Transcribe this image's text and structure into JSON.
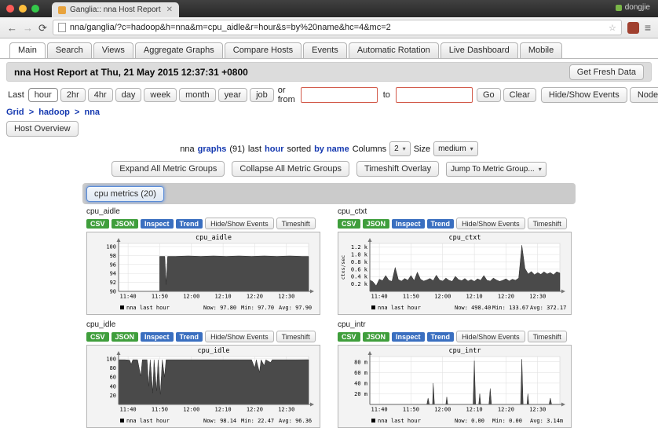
{
  "chrome": {
    "tab_title": "Ganglia:: nna Host Report",
    "profile_name": "dongjie",
    "url": "nna/ganglia/?c=hadoop&h=nna&m=cpu_aidle&r=hour&s=by%20name&hc=4&mc=2"
  },
  "icons": {
    "tab_close": "✕",
    "back": "←",
    "forward": "→",
    "reload": "⟳",
    "bookmark_star": "☆",
    "menu": "≡",
    "select_arrow": "▾"
  },
  "nav_tabs": [
    {
      "label": "Main"
    },
    {
      "label": "Search"
    },
    {
      "label": "Views"
    },
    {
      "label": "Aggregate Graphs"
    },
    {
      "label": "Compare Hosts"
    },
    {
      "label": "Events"
    },
    {
      "label": "Automatic Rotation"
    },
    {
      "label": "Live Dashboard"
    },
    {
      "label": "Mobile"
    }
  ],
  "header": {
    "title": "nna Host Report at Thu, 21 May 2015 12:37:31 +0800",
    "refresh_button": "Get Fresh Data"
  },
  "time_controls": {
    "last_label": "Last",
    "ranges": [
      "hour",
      "2hr",
      "4hr",
      "day",
      "week",
      "month",
      "year",
      "job"
    ],
    "from_label": "or from",
    "to_label": "to",
    "go_button": "Go",
    "clear_button": "Clear",
    "events_button": "Hide/Show Events",
    "node_view_button": "Node View"
  },
  "breadcrumb": {
    "items": [
      "Grid",
      "hadoop",
      "nna"
    ],
    "separator": ">"
  },
  "host_overview_button": "Host Overview",
  "summary": {
    "host": "nna",
    "graphs_link": "graphs",
    "count": "(91)",
    "last_word": "last",
    "range_link": "hour",
    "sorted_word": "sorted",
    "sort_link": "by name",
    "columns_label": "Columns",
    "columns_value": "2",
    "size_label": "Size",
    "size_value": "medium"
  },
  "group_controls": {
    "expand_button": "Expand All Metric Groups",
    "collapse_button": "Collapse All Metric Groups",
    "timeshift_button": "Timeshift Overlay",
    "jump_select": "Jump To Metric Group..."
  },
  "metric_group_button": "cpu metrics (20)",
  "graph_toolbar": {
    "csv": "CSV",
    "json": "JSON",
    "inspect": "Inspect",
    "trend": "Trend",
    "events": "Hide/Show Events",
    "timeshift": "Timeshift"
  },
  "graphs": [
    {
      "name": "cpu_aidle",
      "title": "cpu_aidle",
      "ylabel": "",
      "xmin": 0,
      "xmax": 60,
      "ymin": 90,
      "ymax": 100.7,
      "xticks": [
        {
          "v": 3,
          "t": "11:40"
        },
        {
          "v": 13,
          "t": "11:50"
        },
        {
          "v": 23,
          "t": "12:00"
        },
        {
          "v": 33,
          "t": "12:10"
        },
        {
          "v": 43,
          "t": "12:20"
        },
        {
          "v": 53,
          "t": "12:30"
        }
      ],
      "yticks": [
        {
          "v": 90,
          "t": "90"
        },
        {
          "v": 92,
          "t": "92"
        },
        {
          "v": 94,
          "t": "94"
        },
        {
          "v": 96,
          "t": "96"
        },
        {
          "v": 98,
          "t": "98"
        },
        {
          "v": 100,
          "t": "100"
        }
      ],
      "points": [
        [
          13,
          97.8
        ],
        [
          14.6,
          97.8
        ],
        [
          15,
          91.5
        ],
        [
          15.5,
          97.8
        ],
        [
          18,
          97.8
        ],
        [
          22,
          97.9
        ],
        [
          26,
          97.8
        ],
        [
          30,
          97.9
        ],
        [
          34,
          97.8
        ],
        [
          38,
          97.9
        ],
        [
          42,
          97.8
        ],
        [
          46,
          97.9
        ],
        [
          50,
          97.8
        ],
        [
          54,
          97.9
        ],
        [
          58,
          97.8
        ],
        [
          60,
          97.8
        ]
      ],
      "legend": {
        "series": "nna last hour",
        "now": "Now: 97.80",
        "min": "Min: 97.70",
        "avg": "Avg: 97.90"
      }
    },
    {
      "name": "cpu_ctxt",
      "title": "cpu_ctxt",
      "ylabel": "ctxs/sec",
      "xmin": 0,
      "xmax": 60,
      "ymin": 0,
      "ymax": 1300,
      "xticks": [
        {
          "v": 3,
          "t": "11:40"
        },
        {
          "v": 13,
          "t": "11:50"
        },
        {
          "v": 23,
          "t": "12:00"
        },
        {
          "v": 33,
          "t": "12:10"
        },
        {
          "v": 43,
          "t": "12:20"
        },
        {
          "v": 53,
          "t": "12:30"
        }
      ],
      "yticks": [
        {
          "v": 200,
          "t": "0.2 k"
        },
        {
          "v": 400,
          "t": "0.4 k"
        },
        {
          "v": 600,
          "t": "0.6 k"
        },
        {
          "v": 800,
          "t": "0.8 k"
        },
        {
          "v": 1000,
          "t": "1.0 k"
        },
        {
          "v": 1200,
          "t": "1.2 k"
        }
      ],
      "points": [
        [
          0,
          310
        ],
        [
          1,
          260
        ],
        [
          2,
          150
        ],
        [
          3,
          330
        ],
        [
          4,
          290
        ],
        [
          5,
          430
        ],
        [
          6,
          300
        ],
        [
          7,
          270
        ],
        [
          8,
          650
        ],
        [
          9,
          320
        ],
        [
          10,
          280
        ],
        [
          11,
          350
        ],
        [
          12,
          300
        ],
        [
          13,
          430
        ],
        [
          14,
          290
        ],
        [
          15,
          520
        ],
        [
          16,
          330
        ],
        [
          17,
          280
        ],
        [
          18,
          310
        ],
        [
          19,
          350
        ],
        [
          20,
          290
        ],
        [
          21,
          440
        ],
        [
          22,
          310
        ],
        [
          23,
          280
        ],
        [
          24,
          360
        ],
        [
          25,
          300
        ],
        [
          26,
          270
        ],
        [
          27,
          410
        ],
        [
          28,
          320
        ],
        [
          29,
          290
        ],
        [
          30,
          350
        ],
        [
          31,
          280
        ],
        [
          32,
          320
        ],
        [
          33,
          270
        ],
        [
          34,
          340
        ],
        [
          35,
          300
        ],
        [
          36,
          430
        ],
        [
          37,
          300
        ],
        [
          38,
          280
        ],
        [
          39,
          360
        ],
        [
          40,
          310
        ],
        [
          41,
          270
        ],
        [
          42,
          300
        ],
        [
          43,
          340
        ],
        [
          44,
          280
        ],
        [
          45,
          330
        ],
        [
          46,
          300
        ],
        [
          47,
          360
        ],
        [
          48,
          1250
        ],
        [
          49,
          620
        ],
        [
          50,
          470
        ],
        [
          51,
          540
        ],
        [
          52,
          450
        ],
        [
          53,
          510
        ],
        [
          54,
          460
        ],
        [
          55,
          530
        ],
        [
          56,
          470
        ],
        [
          57,
          510
        ],
        [
          58,
          450
        ],
        [
          59,
          530
        ],
        [
          60,
          498
        ]
      ],
      "legend": {
        "series": "nna last hour",
        "now": "Now: 498.40",
        "min": "Min: 133.67",
        "avg": "Avg: 372.17"
      }
    },
    {
      "name": "cpu_idle",
      "title": "cpu_idle",
      "ylabel": "",
      "xmin": 0,
      "xmax": 60,
      "ymin": 0,
      "ymax": 105,
      "xticks": [
        {
          "v": 3,
          "t": "11:40"
        },
        {
          "v": 13,
          "t": "11:50"
        },
        {
          "v": 23,
          "t": "12:00"
        },
        {
          "v": 33,
          "t": "12:10"
        },
        {
          "v": 43,
          "t": "12:20"
        },
        {
          "v": 53,
          "t": "12:30"
        }
      ],
      "yticks": [
        {
          "v": 20,
          "t": "20"
        },
        {
          "v": 40,
          "t": "40"
        },
        {
          "v": 60,
          "t": "60"
        },
        {
          "v": 80,
          "t": "80"
        },
        {
          "v": 100,
          "t": "100"
        }
      ],
      "points": [
        [
          0,
          98
        ],
        [
          2,
          98
        ],
        [
          3.5,
          97
        ],
        [
          4,
          88
        ],
        [
          4.5,
          98
        ],
        [
          6,
          98
        ],
        [
          7,
          62
        ],
        [
          7.5,
          98
        ],
        [
          9,
          98
        ],
        [
          9.5,
          40
        ],
        [
          10,
          98
        ],
        [
          10.8,
          25
        ],
        [
          11.2,
          98
        ],
        [
          12,
          30
        ],
        [
          12.5,
          98
        ],
        [
          13.2,
          22
        ],
        [
          13.8,
          98
        ],
        [
          14.5,
          60
        ],
        [
          15,
          98
        ],
        [
          18,
          98
        ],
        [
          22,
          98
        ],
        [
          26,
          98
        ],
        [
          30,
          98
        ],
        [
          34,
          98
        ],
        [
          38,
          98
        ],
        [
          42,
          98
        ],
        [
          43,
          80
        ],
        [
          43.5,
          98
        ],
        [
          44.5,
          70
        ],
        [
          45,
          98
        ],
        [
          46,
          85
        ],
        [
          46.5,
          98
        ],
        [
          48,
          92
        ],
        [
          48.5,
          98
        ],
        [
          52,
          98
        ],
        [
          56,
          98
        ],
        [
          60,
          98.1
        ]
      ],
      "legend": {
        "series": "nna last hour",
        "now": "Now: 98.14",
        "min": "Min: 22.47",
        "avg": "Avg: 96.36"
      }
    },
    {
      "name": "cpu_intr",
      "title": "cpu_intr",
      "ylabel": "",
      "xmin": 0,
      "xmax": 60,
      "ymin": 0,
      "ymax": 0.09,
      "xticks": [
        {
          "v": 3,
          "t": "11:40"
        },
        {
          "v": 13,
          "t": "11:50"
        },
        {
          "v": 23,
          "t": "12:00"
        },
        {
          "v": 33,
          "t": "12:10"
        },
        {
          "v": 43,
          "t": "12:20"
        },
        {
          "v": 53,
          "t": "12:30"
        }
      ],
      "yticks": [
        {
          "v": 0.02,
          "t": "20 m"
        },
        {
          "v": 0.04,
          "t": "40 m"
        },
        {
          "v": 0.06,
          "t": "60 m"
        },
        {
          "v": 0.08,
          "t": "80 m"
        }
      ],
      "points": [
        [
          0,
          0
        ],
        [
          18,
          0
        ],
        [
          18.4,
          0.012
        ],
        [
          18.8,
          0
        ],
        [
          19.8,
          0
        ],
        [
          20,
          0.04
        ],
        [
          20.4,
          0
        ],
        [
          24,
          0
        ],
        [
          24.3,
          0.014
        ],
        [
          24.6,
          0
        ],
        [
          32.6,
          0
        ],
        [
          33,
          0.082
        ],
        [
          33.4,
          0
        ],
        [
          34.4,
          0
        ],
        [
          34.7,
          0.02
        ],
        [
          35,
          0
        ],
        [
          37.6,
          0
        ],
        [
          38,
          0.03
        ],
        [
          38.4,
          0
        ],
        [
          47.6,
          0
        ],
        [
          48,
          0.085
        ],
        [
          48.4,
          0
        ],
        [
          49.6,
          0
        ],
        [
          49.9,
          0.02
        ],
        [
          50.2,
          0
        ],
        [
          56.6,
          0
        ],
        [
          57,
          0.012
        ],
        [
          57.4,
          0
        ],
        [
          60,
          0
        ]
      ],
      "legend": {
        "series": "nna last hour",
        "now": "Now: 0.00",
        "min": "Min: 0.00",
        "avg": "Avg: 3.14m"
      }
    }
  ]
}
